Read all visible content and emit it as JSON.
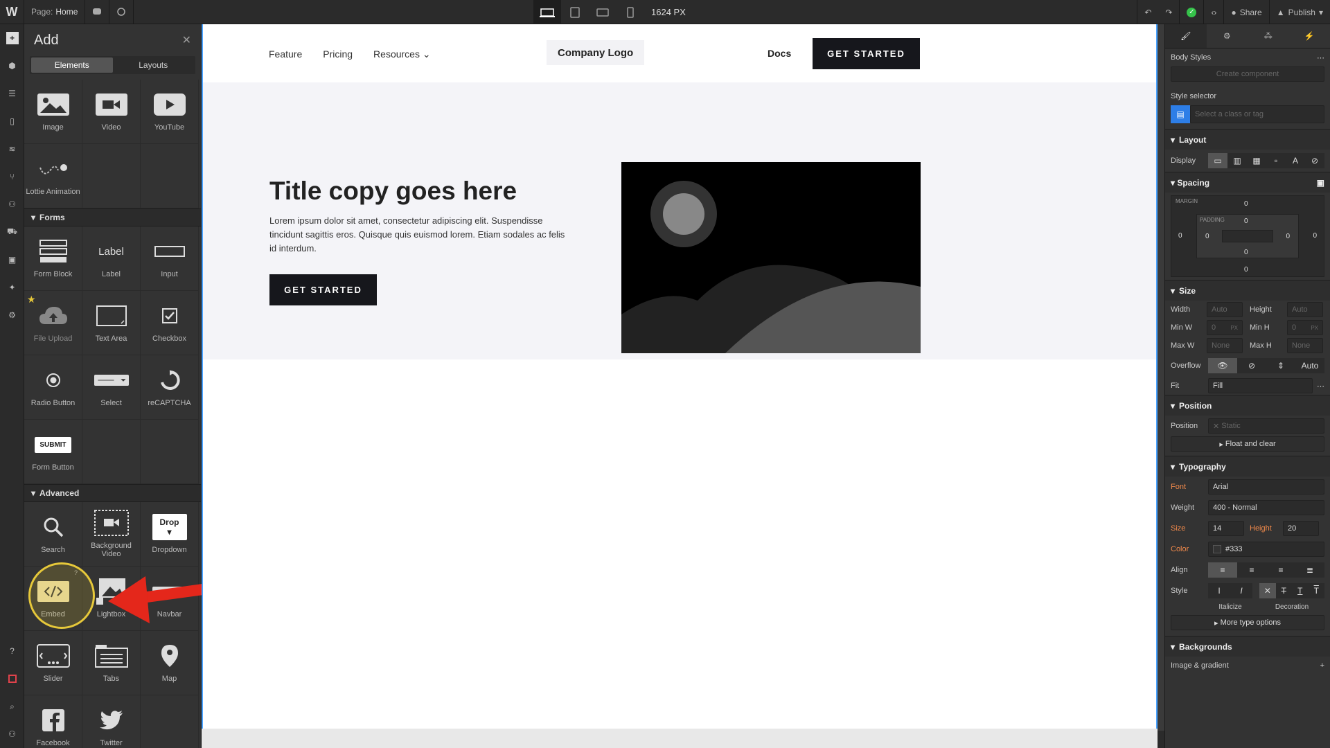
{
  "topbar": {
    "logo": "W",
    "page_label": "Page:",
    "page_name": "Home",
    "width_value": "1624 PX",
    "share_label": "Share",
    "publish_label": "Publish"
  },
  "add_panel": {
    "title": "Add",
    "tabs": [
      {
        "label": "Elements"
      },
      {
        "label": "Layouts"
      }
    ],
    "media_items": [
      {
        "label": "Image",
        "icon": "image-icon"
      },
      {
        "label": "Video",
        "icon": "video-icon"
      },
      {
        "label": "YouTube",
        "icon": "youtube-icon"
      },
      {
        "label": "Lottie Animation",
        "icon": "lottie-icon"
      }
    ],
    "forms_label": "Forms",
    "form_items": [
      {
        "label": "Form Block"
      },
      {
        "label": "Label"
      },
      {
        "label": "Input"
      },
      {
        "label": "File Upload"
      },
      {
        "label": "Text Area"
      },
      {
        "label": "Checkbox"
      },
      {
        "label": "Radio Button"
      },
      {
        "label": "Select"
      },
      {
        "label": "reCAPTCHA"
      },
      {
        "label": "Form Button"
      }
    ],
    "label_glyph": "Label",
    "submit_glyph": "SUBMIT",
    "advanced_label": "Advanced",
    "advanced_items": [
      {
        "label": "Search"
      },
      {
        "label": "Background Video"
      },
      {
        "label": "Dropdown"
      },
      {
        "label": "Embed"
      },
      {
        "label": "Lightbox"
      },
      {
        "label": "Navbar"
      },
      {
        "label": "Slider"
      },
      {
        "label": "Tabs"
      },
      {
        "label": "Map"
      },
      {
        "label": "Facebook"
      },
      {
        "label": "Twitter"
      }
    ],
    "drop_glyph": "Drop"
  },
  "canvas": {
    "nav_links": [
      {
        "label": "Feature"
      },
      {
        "label": "Pricing"
      },
      {
        "label": "Resources"
      }
    ],
    "logo_text": "Company Logo",
    "docs_label": "Docs",
    "nav_cta": "GET STARTED",
    "hero_title": "Title copy goes here",
    "hero_body": "Lorem ipsum dolor sit amet, consectetur adipiscing elit. Suspendisse tincidunt sagittis eros. Quisque quis euismod lorem. Etiam sodales ac felis id interdum.",
    "hero_cta": "GET STARTED"
  },
  "right_panel": {
    "body_styles": "Body Styles",
    "create_component": "Create component",
    "style_selector": "Style selector",
    "selector_placeholder": "Select a class or tag",
    "layout": "Layout",
    "display": "Display",
    "spacing": "Spacing",
    "margin_label": "MARGIN",
    "padding_label": "PADDING",
    "zero": "0",
    "size": "Size",
    "width": "Width",
    "height": "Height",
    "min_w": "Min W",
    "min_h": "Min H",
    "max_w": "Max W",
    "max_h": "Max H",
    "auto": "Auto",
    "none": "None",
    "px": "PX",
    "overflow": "Overflow",
    "overflow_auto": "Auto",
    "fit": "Fit",
    "fit_value": "Fill",
    "position": "Position",
    "position_value": "Static",
    "float_clear": "Float and clear",
    "typography": "Typography",
    "font": "Font",
    "font_value": "Arial",
    "weight": "Weight",
    "weight_value": "400 - Normal",
    "size_lbl": "Size",
    "size_value": "14",
    "height_lbl": "Height",
    "height_value": "20",
    "color": "Color",
    "color_value": "#333",
    "align": "Align",
    "style": "Style",
    "italicize": "Italicize",
    "decoration": "Decoration",
    "more_type": "More type options",
    "backgrounds": "Backgrounds",
    "image_gradient": "Image & gradient"
  }
}
